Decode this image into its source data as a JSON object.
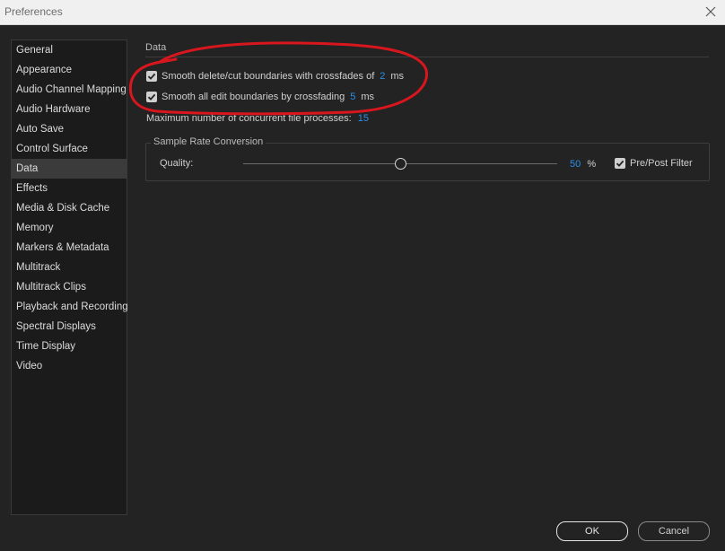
{
  "window": {
    "title": "Preferences"
  },
  "sidebar": {
    "items": [
      {
        "label": "General"
      },
      {
        "label": "Appearance"
      },
      {
        "label": "Audio Channel Mapping"
      },
      {
        "label": "Audio Hardware"
      },
      {
        "label": "Auto Save"
      },
      {
        "label": "Control Surface"
      },
      {
        "label": "Data",
        "selected": true
      },
      {
        "label": "Effects"
      },
      {
        "label": "Media & Disk Cache"
      },
      {
        "label": "Memory"
      },
      {
        "label": "Markers & Metadata"
      },
      {
        "label": "Multitrack"
      },
      {
        "label": "Multitrack Clips"
      },
      {
        "label": "Playback and Recording"
      },
      {
        "label": "Spectral Displays"
      },
      {
        "label": "Time Display"
      },
      {
        "label": "Video"
      }
    ]
  },
  "main": {
    "section_title": "Data",
    "smooth_delete": {
      "checked": true,
      "label": "Smooth delete/cut boundaries with crossfades of",
      "value": "2",
      "unit": "ms"
    },
    "smooth_edit": {
      "checked": true,
      "label": "Smooth all edit boundaries by crossfading",
      "value": "5",
      "unit": "ms"
    },
    "max_processes": {
      "label": "Maximum number of concurrent file processes:",
      "value": "15"
    },
    "sample_rate": {
      "group_title": "Sample Rate Conversion",
      "quality_label": "Quality:",
      "quality_value": "50",
      "quality_unit": "%",
      "quality_level": 0.5,
      "prepost_label": "Pre/Post Filter",
      "prepost_checked": true
    }
  },
  "footer": {
    "ok_label": "OK",
    "cancel_label": "Cancel"
  },
  "colors": {
    "background": "#232323",
    "accent_value": "#2b8fe8",
    "annotation": "#d8161e"
  },
  "icons": {
    "close": "close-icon",
    "checkmark": "checkmark-icon"
  }
}
